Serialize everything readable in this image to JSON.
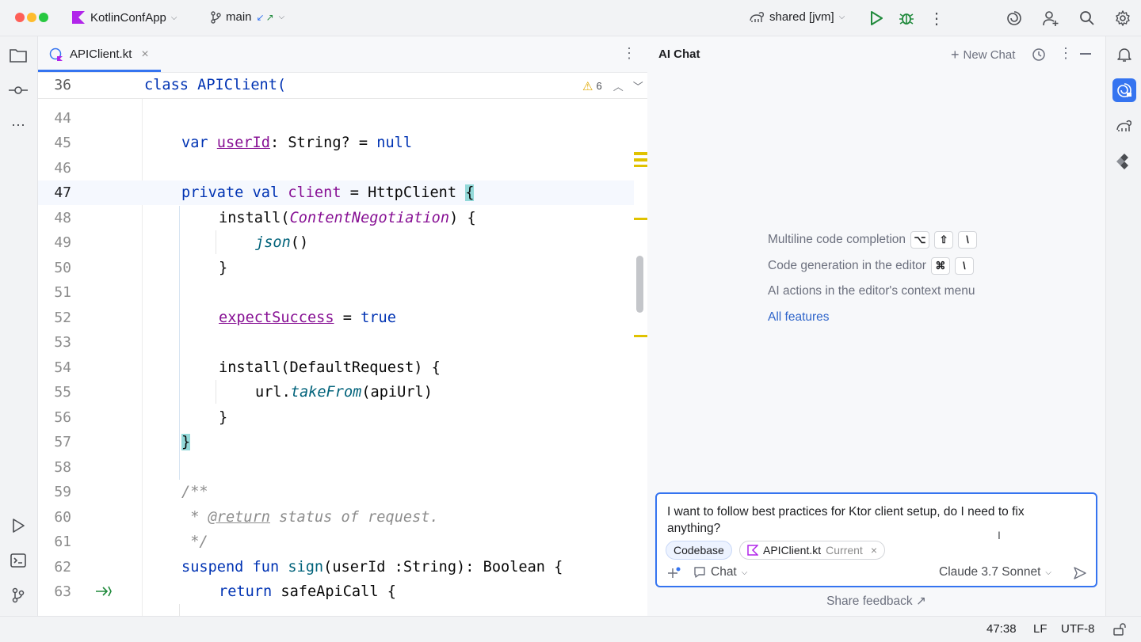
{
  "titlebar": {
    "project": "KotlinConfApp",
    "branch": "main",
    "run_config": "shared [jvm]"
  },
  "tab": {
    "filename": "APIClient.kt",
    "close": "×"
  },
  "sticky": {
    "line_number": "36",
    "code": "class APIClient(",
    "warning_count": "6"
  },
  "code_lines": [
    {
      "n": "44"
    },
    {
      "n": "45"
    },
    {
      "n": "46"
    },
    {
      "n": "47"
    },
    {
      "n": "48"
    },
    {
      "n": "49"
    },
    {
      "n": "50"
    },
    {
      "n": "51"
    },
    {
      "n": "52"
    },
    {
      "n": "53"
    },
    {
      "n": "54"
    },
    {
      "n": "55"
    },
    {
      "n": "56"
    },
    {
      "n": "57"
    },
    {
      "n": "58"
    },
    {
      "n": "59"
    },
    {
      "n": "60"
    },
    {
      "n": "61"
    },
    {
      "n": "62"
    },
    {
      "n": "63"
    }
  ],
  "code": {
    "l45_kw": "var ",
    "l45_prop": "userId",
    "l45_rest": ": String? = ",
    "l45_null": "null",
    "l47_kw": "private val ",
    "l47_name": "client",
    "l47_rest": " = HttpClient ",
    "l47_brace": "{",
    "l48_a": "install(",
    "l48_it": "ContentNegotiation",
    "l48_b": ") {",
    "l49_it": "json",
    "l49_b": "()",
    "l50": "}",
    "l52_prop": "expectSuccess",
    "l52_rest": " = ",
    "l52_kw": "true",
    "l54": "install(DefaultRequest) {",
    "l55_a": "url.",
    "l55_it": "takeFrom",
    "l55_b": "(apiUrl)",
    "l56": "}",
    "l57": "}",
    "l59": "/**",
    "l60_a": " * ",
    "l60_tag": "@return",
    "l60_b": " status of request.",
    "l61": " */",
    "l62_kw": "suspend fun ",
    "l62_fn": "sign",
    "l62_rest": "(userId :String): Boolean {",
    "l63_kw": "return ",
    "l63_rest": "safeApiCall {"
  },
  "chat": {
    "title": "AI Chat",
    "new_chat": "New Chat",
    "hints": [
      {
        "text": "Multiline code completion",
        "keys": [
          "⌥",
          "⇧",
          "\\"
        ]
      },
      {
        "text": "Code generation in the editor",
        "keys": [
          "⌘",
          "\\"
        ]
      },
      {
        "text": "AI actions in the editor's context menu",
        "keys": []
      }
    ],
    "all_features": "All features",
    "input_text": "I want to follow best practices for Ktor client setup, do I need to fix anything?",
    "chip_codebase": "Codebase",
    "chip_file": "APIClient.kt",
    "chip_file_note": "Current",
    "mode": "Chat",
    "model": "Claude 3.7 Sonnet",
    "share_feedback": "Share feedback ↗"
  },
  "status": {
    "position": "47:38",
    "line_sep": "LF",
    "encoding": "UTF-8"
  },
  "colors": {
    "accent": "#3574f0",
    "brace_highlight": "#93d9d9",
    "warning": "#e0a800"
  }
}
